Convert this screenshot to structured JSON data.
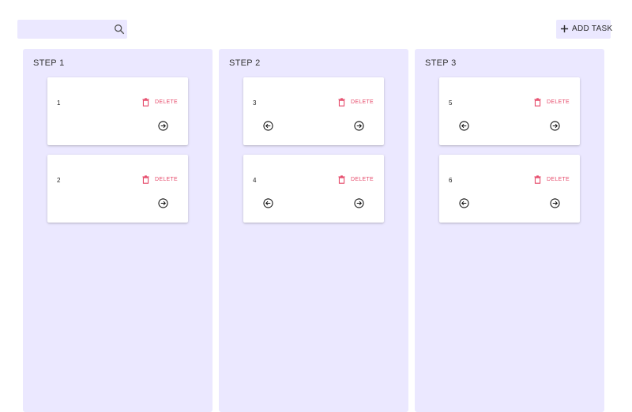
{
  "search": {
    "placeholder": "",
    "value": ""
  },
  "toolbar": {
    "add_task_label": "ADD TASK"
  },
  "colors": {
    "column_bg": "#ebe8ff",
    "delete_red": "#e64a6a",
    "card_bg": "#ffffff"
  },
  "columns": [
    {
      "title": "STEP 1",
      "cards": [
        {
          "number": "1",
          "delete_label": "DELETE"
        },
        {
          "number": "2",
          "delete_label": "DELETE"
        }
      ]
    },
    {
      "title": "STEP 2",
      "cards": [
        {
          "number": "3",
          "delete_label": "DELETE"
        },
        {
          "number": "4",
          "delete_label": "DELETE"
        }
      ]
    },
    {
      "title": "STEP 3",
      "cards": [
        {
          "number": "5",
          "delete_label": "DELETE"
        },
        {
          "number": "6",
          "delete_label": "DELETE"
        }
      ]
    }
  ],
  "icons": {
    "search": "search-icon",
    "add": "plus-icon",
    "delete": "trash-icon",
    "move_left": "arrow-left-circle-icon",
    "move_right": "arrow-right-circle-icon"
  }
}
